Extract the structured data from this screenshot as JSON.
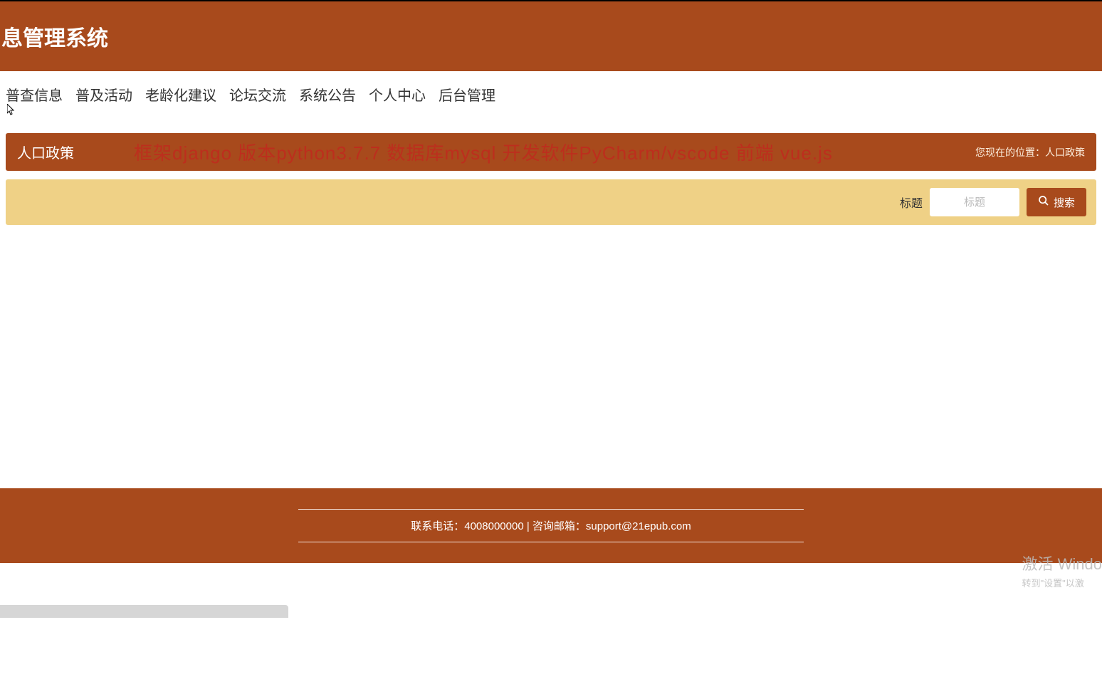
{
  "header": {
    "title": "息管理系统"
  },
  "nav": {
    "items": [
      "普查信息",
      "普及活动",
      "老龄化建议",
      "论坛交流",
      "系统公告",
      "个人中心",
      "后台管理"
    ]
  },
  "section": {
    "title": "人口政策",
    "watermark": "框架django 版本python3.7.7 数据库mysql  开发软件PyCharm/vscode 前端 vue.js",
    "breadcrumb_label": "您现在的位置：",
    "breadcrumb_current": "人口政策"
  },
  "search": {
    "label": "标题",
    "placeholder": "标题",
    "button": "搜索"
  },
  "footer": {
    "contact": "联系电话：4008000000 | 咨询邮箱：support@21epub.com"
  },
  "windows": {
    "title": "激活 Windo",
    "sub": "转到\"设置\"以激"
  }
}
